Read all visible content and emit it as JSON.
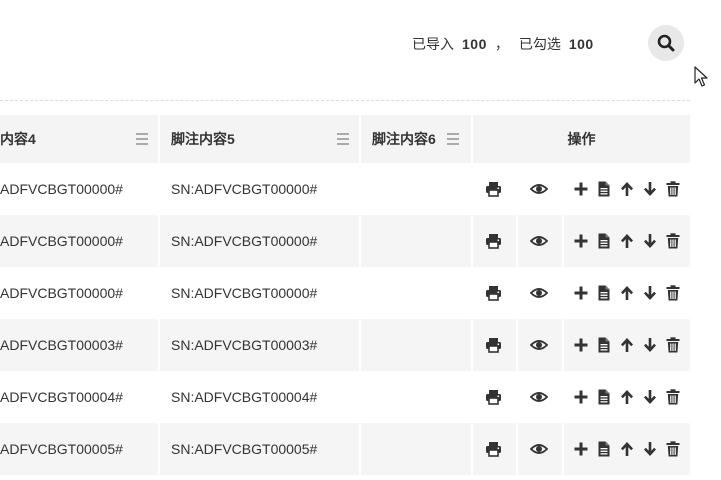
{
  "summary": {
    "imported_label": "已导入",
    "imported_count": "100",
    "separator": "，",
    "selected_label": "已勾选",
    "selected_count": "100"
  },
  "toolbar": {
    "search_icon": "search-icon"
  },
  "table": {
    "headers": {
      "col4": "内容4",
      "col5": "脚注内容5",
      "col6": "脚注内容6",
      "ops": "操作"
    },
    "rows": [
      {
        "col4": "ADFVCBGT00000#",
        "col5": "SN:ADFVCBGT00000#",
        "col6": ""
      },
      {
        "col4": "ADFVCBGT00000#",
        "col5": "SN:ADFVCBGT00000#",
        "col6": ""
      },
      {
        "col4": "ADFVCBGT00000#",
        "col5": "SN:ADFVCBGT00000#",
        "col6": ""
      },
      {
        "col4": "ADFVCBGT00003#",
        "col5": "SN:ADFVCBGT00003#",
        "col6": ""
      },
      {
        "col4": "ADFVCBGT00004#",
        "col5": "SN:ADFVCBGT00004#",
        "col6": ""
      },
      {
        "col4": "ADFVCBGT00005#",
        "col5": "SN:ADFVCBGT00005#",
        "col6": ""
      }
    ],
    "row_icons": [
      "printer-icon",
      "eye-icon",
      "plus-icon",
      "file-icon",
      "arrow-up-icon",
      "arrow-down-icon",
      "trash-icon"
    ]
  },
  "colors": {
    "header_bg": "#f4f4f4",
    "stripe_bg": "#f5f5f5",
    "icon": "#333333"
  }
}
